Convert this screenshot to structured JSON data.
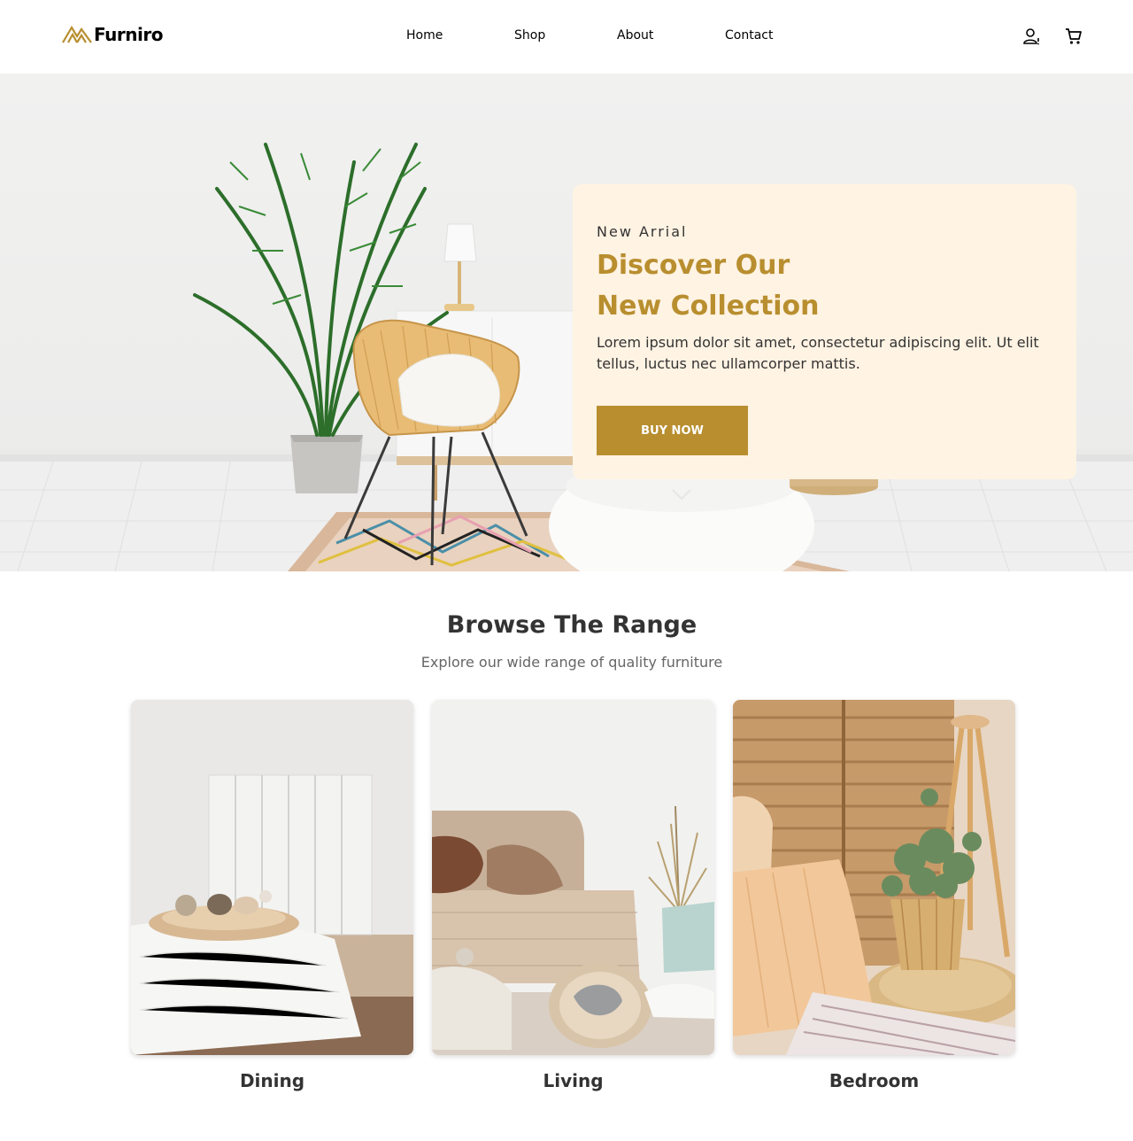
{
  "brand": {
    "name": "Furniro",
    "accent": "#b88e2f"
  },
  "nav": {
    "items": [
      "Home",
      "Shop",
      "About",
      "Contact"
    ]
  },
  "header_icons": [
    "user-icon",
    "cart-icon"
  ],
  "hero": {
    "eyebrow": "New Arrial",
    "title_line1": "Discover Our",
    "title_line2": "New Collection",
    "description": "Lorem ipsum dolor sit amet, consectetur adipiscing elit. Ut elit tellus, luctus nec ullamcorper mattis.",
    "button": "BUY NOW",
    "card_bg": "#fff3e3"
  },
  "browse": {
    "title": "Browse The Range",
    "subtitle": "Explore our wide range of quality furniture",
    "categories": [
      {
        "label": "Dining"
      },
      {
        "label": "Living"
      },
      {
        "label": "Bedroom"
      }
    ]
  }
}
